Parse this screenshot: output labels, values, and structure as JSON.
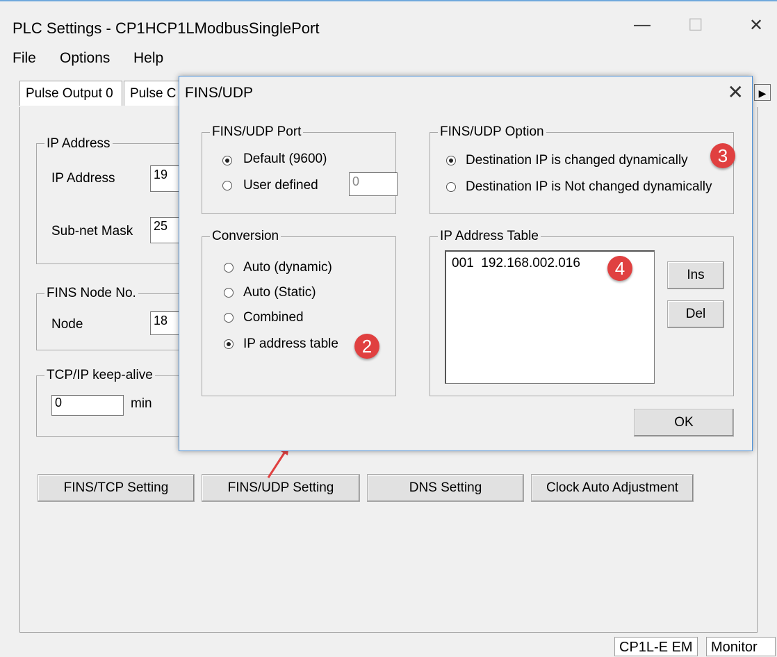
{
  "window": {
    "title": "PLC Settings - CP1HCP1LModbusSinglePort",
    "minimize": "—",
    "maximize": "☐",
    "close": "✕"
  },
  "menu": [
    "File",
    "Options",
    "Help"
  ],
  "tabs": [
    "Pulse Output 0",
    "Pulse C"
  ],
  "tab_scroll": "▶",
  "main": {
    "ip_group": {
      "legend": "IP Address",
      "ip_label": "IP Address",
      "ip_value": "19",
      "mask_label": "Sub-net Mask",
      "mask_value": "25"
    },
    "fins_node_group": {
      "legend": "FINS Node No.",
      "node_label": "Node",
      "node_value": "18"
    },
    "keepalive_group": {
      "legend": "TCP/IP keep-alive",
      "value": "0",
      "unit": "min"
    },
    "buttons": [
      "FINS/TCP Setting",
      "FINS/UDP Setting",
      "DNS Setting",
      "Clock Auto Adjustment"
    ]
  },
  "dialog": {
    "title": "FINS/UDP",
    "close": "✕",
    "port_group": {
      "legend": "FINS/UDP Port",
      "options": [
        "Default (9600)",
        "User defined"
      ],
      "selected": 0,
      "user_value": "0"
    },
    "option_group": {
      "legend": "FINS/UDP Option",
      "options": [
        "Destination IP is changed dynamically",
        "Destination IP is Not changed dynamically"
      ],
      "selected": 0
    },
    "conversion_group": {
      "legend": "Conversion",
      "options": [
        "Auto (dynamic)",
        "Auto (Static)",
        "Combined",
        "IP address table"
      ],
      "selected": 3
    },
    "ip_table_group": {
      "legend": "IP Address Table",
      "rows": [
        "001  192.168.002.016"
      ],
      "ins_label": "Ins",
      "del_label": "Del"
    },
    "ok_label": "OK"
  },
  "badges": [
    "2",
    "3",
    "4"
  ],
  "status": [
    "CP1L-E EM",
    "Monitor"
  ],
  "colors": {
    "badge": "#e04040",
    "dialog_border": "#4a90d9",
    "arrow": "#e04040"
  }
}
